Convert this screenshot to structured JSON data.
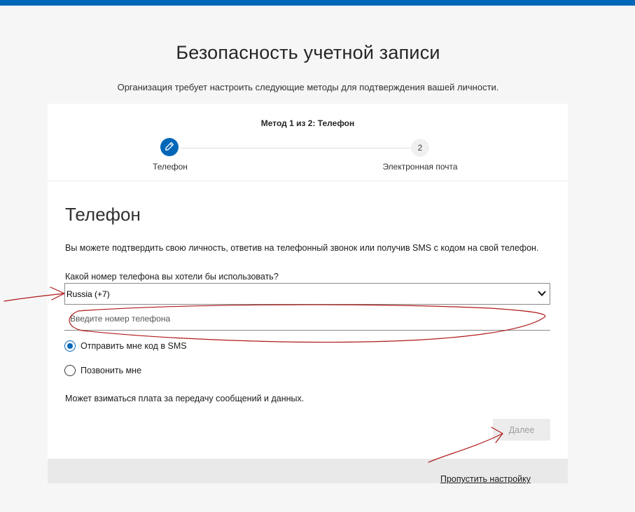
{
  "colors": {
    "brand_bar": "#0067b8",
    "accent": "#0067b8",
    "annotation_ink": "#b01919"
  },
  "header": {
    "title": "Безопасность учетной записи",
    "subtitle": "Организация требует настроить следующие методы для подтверждения вашей личности."
  },
  "progress": {
    "caption": "Метод 1 из 2: Телефон",
    "steps": [
      {
        "label": "Телефон",
        "icon": "pencil-icon",
        "state": "current"
      },
      {
        "label": "Электронная почта",
        "number": "2",
        "state": "pending"
      }
    ]
  },
  "form": {
    "heading": "Телефон",
    "description": "Вы можете подтвердить свою личность, ответив на телефонный звонок или получив SMS с кодом на свой телефон.",
    "question": "Какой номер телефона вы хотели бы использовать?",
    "country_select": {
      "value": "Russia (+7)",
      "icon": "chevron-down-icon"
    },
    "phone_input": {
      "value": "",
      "placeholder": "Введите номер телефона"
    },
    "options": [
      {
        "label": "Отправить мне код в SMS",
        "checked": true
      },
      {
        "label": "Позвонить мне",
        "checked": false
      }
    ],
    "fees_note": "Может взиматься плата за передачу сообщений и данных.",
    "next_label": "Далее"
  },
  "footer": {
    "skip_label": "Пропустить настройку"
  }
}
